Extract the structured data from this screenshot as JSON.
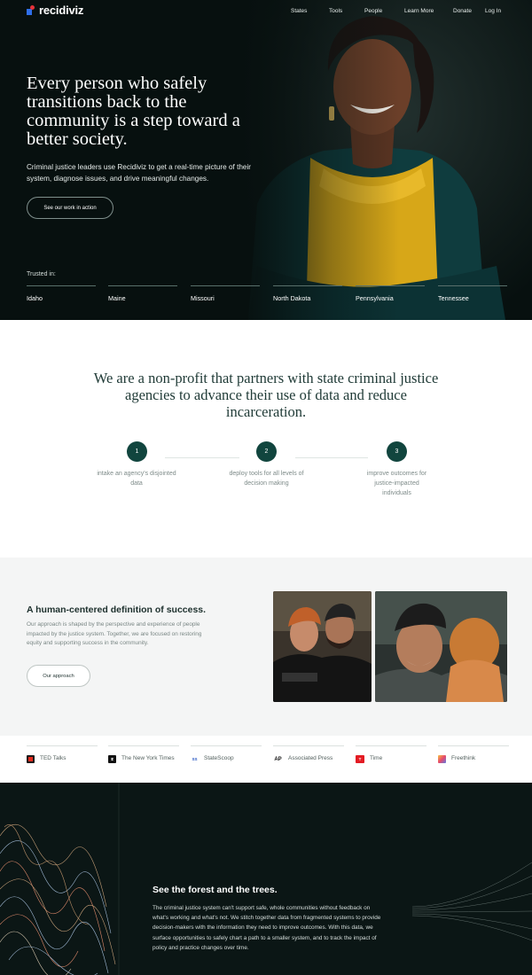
{
  "nav": {
    "logo_text": "recidiviz",
    "links": [
      "States",
      "Tools",
      "People",
      "Learn More",
      "Donate",
      "Log In"
    ]
  },
  "hero": {
    "headline": "Every person who safely transitions back to the community is a step toward a better society.",
    "subtext": "Criminal justice leaders use Recidiviz to get a real-time picture of their system, diagnose issues, and drive meaningful changes.",
    "cta_label": "See our work in action",
    "trusted_label": "Trusted in:",
    "states": [
      "Idaho",
      "Maine",
      "Missouri",
      "North Dakota",
      "Pennsylvania",
      "Tennessee"
    ]
  },
  "mission": {
    "heading": "We are a non-profit that partners with state criminal justice agencies to advance their use of data and reduce incarceration.",
    "steps": [
      {
        "number": "1",
        "text": "intake an agency's disjointed data"
      },
      {
        "number": "2",
        "text": "deploy tools for all levels of decision making"
      },
      {
        "number": "3",
        "text": "improve outcomes for justice-impacted individuals"
      }
    ]
  },
  "success": {
    "heading": "A human-centered definition of success.",
    "body": "Our approach is shaped by the perspective and experience of people impacted by the justice system. Together, we are focused on restoring equity and supporting success in the community.",
    "button_label": "Our approach"
  },
  "press": [
    {
      "label": "TED Talks",
      "icon": "ted-icon",
      "color": "#1a1a1a"
    },
    {
      "label": "The New York Times",
      "icon": "nyt-icon",
      "color": "#111111"
    },
    {
      "label": "StateScoop",
      "icon": "statescoop-icon",
      "color": "#2b59c3"
    },
    {
      "label": "Associated Press",
      "icon": "ap-icon",
      "color": "#e0262d"
    },
    {
      "label": "Time",
      "icon": "time-icon",
      "color": "#e31b23"
    },
    {
      "label": "Freethink",
      "icon": "freethink-icon",
      "color": "#f08a3c"
    }
  ],
  "forest": {
    "heading": "See the forest and the trees.",
    "body": "The criminal justice system can't support safe, whole communities without feedback on what's working and what's not. We stitch together data from fragmented systems to provide decision-makers with the information they need to improve outcomes. With this data, we surface opportunities to safely chart a path to a smaller system, and to track the impact of policy and practice changes over time."
  },
  "colors": {
    "hero_bg": "#07100f",
    "accent_green": "#11453e",
    "section_grey": "#f4f5f5",
    "forest_bg": "#0b1615"
  }
}
